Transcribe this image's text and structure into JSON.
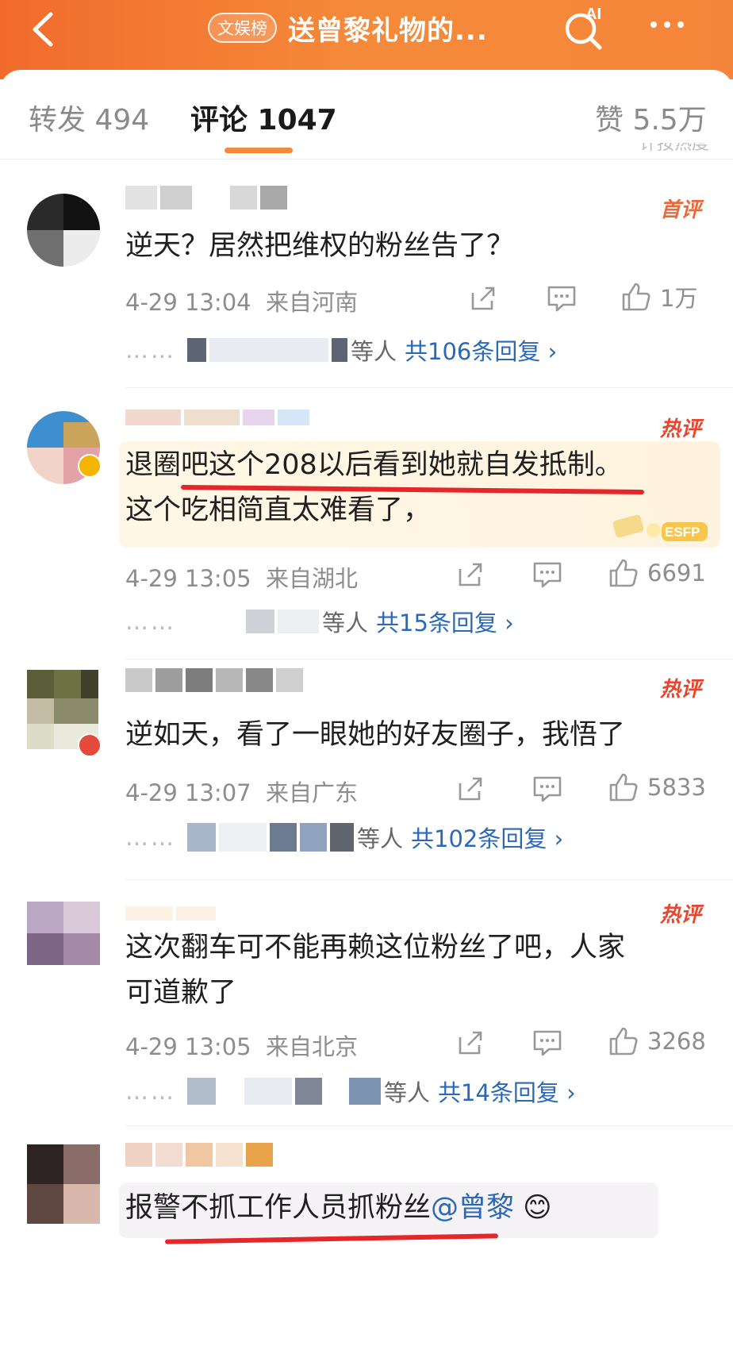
{
  "header": {
    "tag": "文娱榜",
    "title": "送曾黎礼物的..."
  },
  "tabs": {
    "repost": "转发 494",
    "comment": "评论 1047",
    "like": "赞 5.5万",
    "sort_hint": "计按热度"
  },
  "comments": [
    {
      "badge": "首评",
      "text": "逆天？居然把维权的粉丝告了？",
      "time": "4-29 13:04",
      "location": "来自河南",
      "likes": "1万",
      "reply_suffix": "等人",
      "reply_count": "共106条回复 ›"
    },
    {
      "badge": "热评",
      "text_line1": "退圈吧这个208以后看到她就自发抵制。",
      "text_line2": "这个吃相简直太难看了，",
      "time": "4-29 13:05",
      "location": "来自湖北",
      "likes": "6691",
      "reply_suffix": "等人",
      "reply_count": "共15条回复 ›"
    },
    {
      "badge": "热评",
      "text": "逆如天，看了一眼她的好友圈子，我悟了",
      "time": "4-29 13:07",
      "location": "来自广东",
      "likes": "5833",
      "reply_suffix": "等人",
      "reply_count": "共102条回复 ›"
    },
    {
      "badge": "热评",
      "text_line1": "这次翻车可不能再赖这位粉丝了吧，人家",
      "text_line2": "可道歉了",
      "time": "4-29 13:05",
      "location": "来自北京",
      "likes": "3268",
      "reply_suffix": "等人",
      "reply_count": "共14条回复 ›"
    },
    {
      "text": "报警不抓工作人员抓粉丝",
      "mention": "@曾黎",
      "emoji": "😊"
    }
  ],
  "colors": {
    "header": "#f26b2c",
    "accent": "#f5893b",
    "link": "#2b69b8",
    "hot_badge": "#e8442f",
    "red_mark": "#e5262a"
  }
}
